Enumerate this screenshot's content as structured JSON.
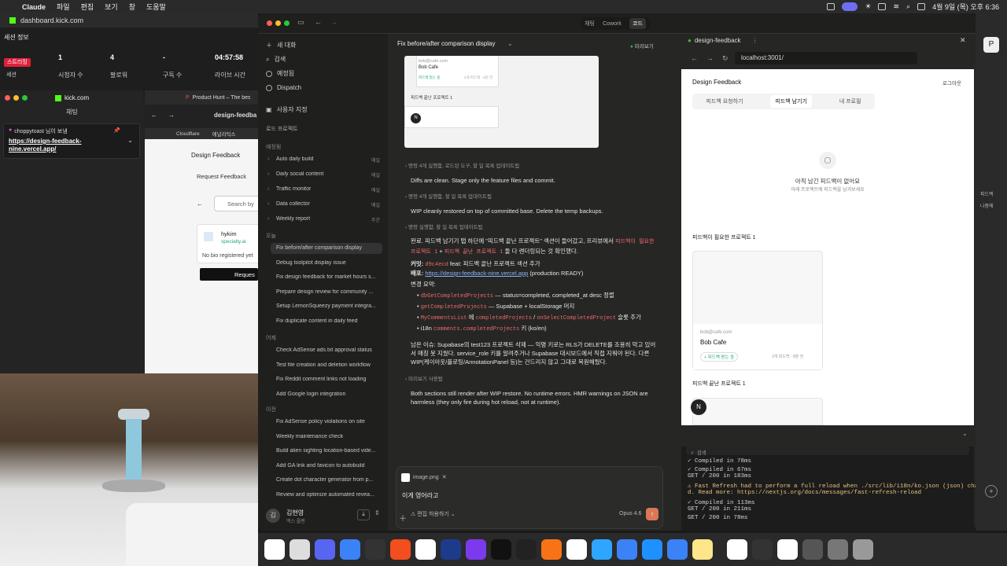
{
  "menubar": {
    "items": [
      "Claude",
      "파일",
      "편집",
      "보기",
      "창",
      "도움말"
    ],
    "date_time": "4월 9일 (목) 오후 6:36"
  },
  "left_browser": {
    "url": "dashboard.kick.com",
    "session_title": "세션 정보",
    "live_badge": "스트리밍",
    "session_label": "세션",
    "stats": [
      {
        "value": "1",
        "label": "시청자 수"
      },
      {
        "value": "4",
        "label": "팔로워"
      },
      {
        "value": "-",
        "label": "구독 수"
      },
      {
        "value": "04:57:58",
        "label": "라이브 시간"
      }
    ],
    "chat_tab_domain": "kick.com",
    "chat_tab_label": "채팅",
    "chat_user": "choppytoast 님이 보냄",
    "chat_message": "https://design-feedback-nine.vercel.app/",
    "ph_tab": "Product Hunt – The bes",
    "df_tab": "design-feedba",
    "bookmark1": "Cloudflare",
    "bookmark2": "애널리틱스",
    "df_title": "Design Feedback",
    "df_request": "Request Feedback",
    "df_search": "Search by",
    "df_user": "hykim",
    "df_user_sub": "specialty.ai",
    "df_nobio": "No bio registered yet",
    "df_button": "Reques"
  },
  "claude": {
    "tabs": [
      "채팅",
      "Cowork",
      "코드"
    ],
    "sidebar": {
      "new_chat": "새 대화",
      "search": "검색",
      "scheduled": "예정됨",
      "dispatch": "Dispatch",
      "customize": "사용자 지정",
      "project_label": "로드 프로젝트",
      "scheduled_section": "예정됨",
      "scheduled_items": [
        {
          "label": "Auto daily build",
          "tag": "매일"
        },
        {
          "label": "Daily social content",
          "tag": "매일"
        },
        {
          "label": "Traffic monitor",
          "tag": "매일"
        },
        {
          "label": "Data collector",
          "tag": "매일"
        },
        {
          "label": "Weekly report",
          "tag": "주간"
        }
      ],
      "today_section": "오늘",
      "today_items": [
        "Fix before/after comparison display",
        "Debug toolpilot display issue",
        "Fix design feedback for market hours s...",
        "Prepare design review for community ...",
        "Setup LemonSqueezy payment integra...",
        "Fix duplicate content in daily feed"
      ],
      "yesterday_section": "어제",
      "yesterday_items": [
        "Check AdSense ads.txt approval status",
        "Test file creation and deletion workflow",
        "Fix Reddit comment links not loading",
        "Add Google login integration"
      ],
      "older_section": "이전",
      "older_items": [
        "Fix AdSense policy violations on site",
        "Weekly maintenance check",
        "Build alien sighting location-based vide...",
        "Add GA link and favicon to autobuild",
        "Create dot character generator from p...",
        "Review and optimize automated revea..."
      ],
      "user_name": "김현영",
      "user_plan": "맥스 플랜"
    },
    "chat": {
      "title": "Fix before/after comparison display",
      "preview_label": "미리보기",
      "card_email": "bob@cafe.com",
      "card_name": "Bob Cafe",
      "card_badge": "피드백 받는 중",
      "card_meta": "3개 피드백 · 8분 전",
      "card_section": "피드백 끝난 프로젝트 1",
      "steps": [
        {
          "sub": "명령 4개 실행함, 로드된 도구, 할 일 목록 업데이트됨",
          "text": "Diffs are clean. Stage only the feature files and commit."
        },
        {
          "sub": "명령 4개 실행함, 할 일 목록 업데이트됨",
          "text": "WIP cleanly restored on top of committed base. Delete the temp backups."
        },
        {
          "sub": "명령 실행함, 할 일 목록 업데이트됨",
          "text": ""
        }
      ],
      "done_text_1": "완료. 피드백 남기기 탭 하단에 \"피드백 끝난 프로젝트\" 섹션이 들어갔고, 프리뷰에서",
      "done_code_1": "피드백이 필요한 프로젝트 1",
      "done_text_2": "+",
      "done_code_2": "피드백 끝난 프로젝트 1",
      "done_text_3": "둘 다 렌더링되는 것 확인했다.",
      "commit_label": "커밋:",
      "commit_hash": "d9c4ecd",
      "commit_msg": "feat: 피드백 끝난 프로젝트 섹션 추가",
      "deploy_label": "배포:",
      "deploy_url": "https://design-feedback-nine.vercel.app",
      "deploy_status": "(production READY)",
      "summary_label": "변경 요약:",
      "bullets": [
        {
          "code": "dbGetCompletedProjects",
          "text": "— status=completed, completed_at desc 정렬"
        },
        {
          "code": "getCompletedProjects",
          "text": "— Supabase + localStorage 머지"
        },
        {
          "code": "MyCommentsList",
          "text": "에",
          "code2": "completedProjects",
          "text2": "/",
          "code3": "onSelectCompletedProject",
          "text3": "슬롯 추가"
        },
        {
          "code": "comments.completedProjects",
          "text": "키 (ko/en)",
          "prefix": "i18n"
        }
      ],
      "remaining_1": "남은 이슈: Supabase의 test123 프로젝트 삭제 — 익명 키로는 RLS가 DELETE를 조용히 막고 있어",
      "remaining_2": "서 매칭 못 지웠다. service_role 키를 알려주거나 Supabase 대시보드에서 직접 지워야 된다. 다른",
      "remaining_3": "WIP(케이아웃/플로팅/AnnotationPanel 등)는 건드리지 않고 그대로 복원해뒀다.",
      "preview_sub": "미리보기 사용됨",
      "final_text": "Both sections still render after WIP restore. No runtime errors. HMR warnings on JSON are harmless (they only fire during hot reload, not at runtime).",
      "attachment": "image.png",
      "input_text": "이게 영어라고",
      "permission": "편집 허용하기",
      "model": "Opus 4.6"
    },
    "webpane": {
      "tab": "design-feedback",
      "url": "localhost:3001/",
      "app_title": "Design Feedback",
      "logout": "로그아웃",
      "tabs": [
        "피드백 요청하기",
        "피드백 남기기",
        "내 프로필"
      ],
      "empty_title": "아직 남긴 피드백이 없어요",
      "empty_sub": "아래 프로젝트에 피드백을 남겨보세요",
      "needs_section": "피드백이 필요한 프로젝트 1",
      "card_email": "bob@cafe.com",
      "card_name": "Bob Cafe",
      "card_badge": "피드백 받는 중",
      "card_meta": "3개 피드백 · 8분 전",
      "done_section": "피드백 끝난 프로젝트 1",
      "term_search": "검색",
      "term_lines": [
        "✓ Compiled in 78ms",
        "✓ Compiled in 67ms",
        "GET / 200 in 183ms",
        "⚠ Fast Refresh had to perform a full reload when ./src/lib/i18n/ko.json (json) change",
        "d. Read more: https://nextjs.org/docs/messages/fast-refresh-reload",
        "✓ Compiled in 113ms",
        "GET / 200 in 211ms",
        "GET / 200 in 78ms"
      ]
    }
  },
  "right_strip": [
    "피드백",
    "나중에"
  ],
  "colors": {
    "accent": "#d97757",
    "live": "#e0203a",
    "kick": "#53fc18",
    "link": "#8ab4f8",
    "code": "#e86a6a"
  }
}
